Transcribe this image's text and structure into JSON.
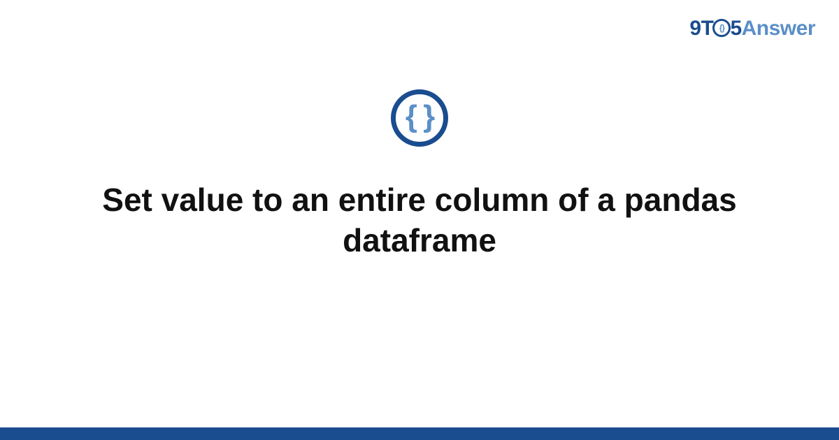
{
  "brand": {
    "nine": "9",
    "t": "T",
    "o_inner": "{}",
    "five": "5",
    "answer": "Answer"
  },
  "icon": {
    "name": "code-braces-icon",
    "glyph": "{ }"
  },
  "title": "Set value to an entire column of a pandas dataframe",
  "colors": {
    "brand_dark": "#1a4d8f",
    "brand_light": "#5b8fc7",
    "text": "#111111",
    "background": "#ffffff"
  }
}
